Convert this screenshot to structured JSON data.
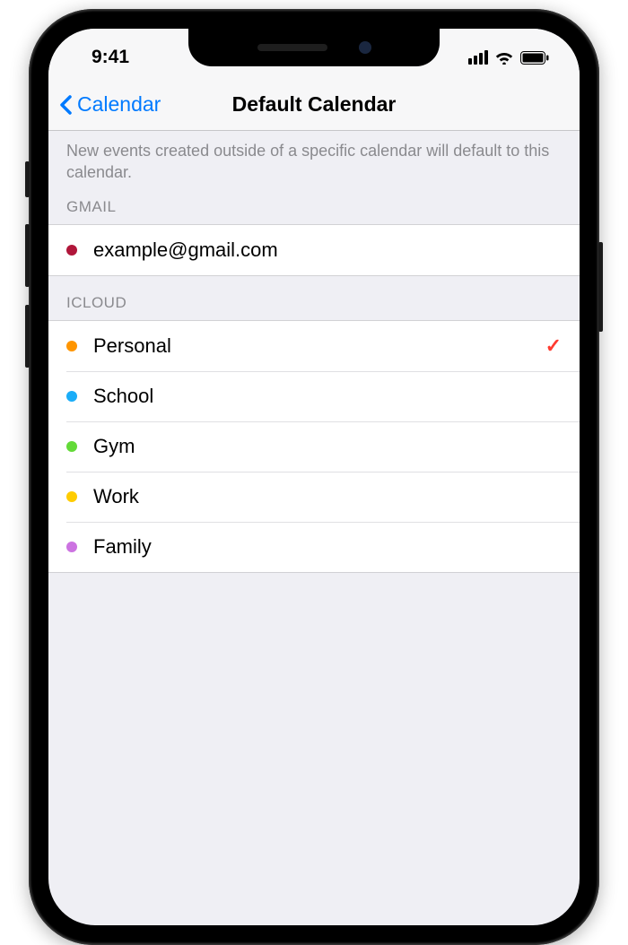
{
  "status": {
    "time": "9:41"
  },
  "nav": {
    "back_label": "Calendar",
    "title": "Default Calendar"
  },
  "description": "New events created outside of a specific calendar will default to this calendar.",
  "sections": {
    "gmail": {
      "header": "GMAIL",
      "items": [
        {
          "label": "example@gmail.com",
          "color": "#b0163a",
          "selected": false
        }
      ]
    },
    "icloud": {
      "header": "ICLOUD",
      "items": [
        {
          "label": "Personal",
          "color": "#ff9500",
          "selected": true
        },
        {
          "label": "School",
          "color": "#1badf8",
          "selected": false
        },
        {
          "label": "Gym",
          "color": "#63da38",
          "selected": false
        },
        {
          "label": "Work",
          "color": "#ffcc00",
          "selected": false
        },
        {
          "label": "Family",
          "color": "#cc73e1",
          "selected": false
        }
      ]
    }
  },
  "checkmark_glyph": "✓"
}
